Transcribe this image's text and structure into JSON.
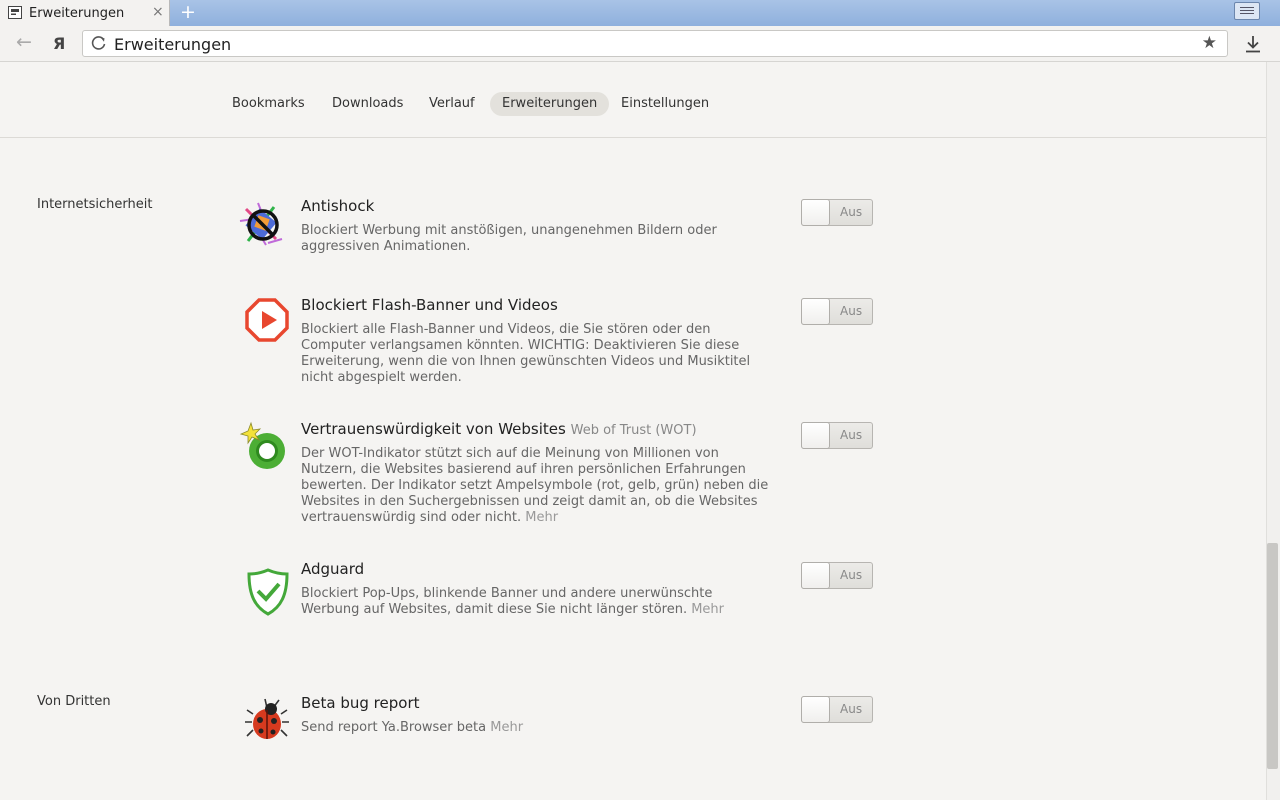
{
  "tab": {
    "title": "Erweiterungen",
    "close": "×"
  },
  "newtab": "+",
  "toolbar": {
    "address": "Erweiterungen",
    "back": "←",
    "ya": "Я",
    "star": "★"
  },
  "nav": [
    "Bookmarks",
    "Downloads",
    "Verlauf",
    "Erweiterungen",
    "Einstellungen"
  ],
  "nav_active": "Erweiterungen",
  "sections": {
    "security": "Internetsicherheit",
    "third": "Von Dritten"
  },
  "extensions": [
    {
      "title": "Antishock",
      "subtitle": "",
      "desc": "Blockiert Werbung mit anstößigen, unangenehmen Bildern oder aggressiven Animationen.",
      "more": "",
      "icon": "antishock-icon",
      "toggle": "Aus"
    },
    {
      "title": "Blockiert Flash-Banner und Videos",
      "subtitle": "",
      "desc": "Blockiert alle Flash-Banner und Videos, die Sie stören oder den Computer verlangsamen könnten. WICHTIG: Deaktivieren Sie diese Erweiterung, wenn die von Ihnen gewünschten Videos und Musiktitel nicht abgespielt werden.",
      "more": "",
      "icon": "flash-blocker-icon",
      "toggle": "Aus"
    },
    {
      "title": "Vertrauenswürdigkeit von Websites",
      "subtitle": "Web of Trust (WOT)",
      "desc": "Der WOT-Indikator stützt sich auf die Meinung von Millionen von Nutzern, die Websites basierend auf ihren persönlichen Erfahrungen bewerten. Der Indikator setzt Ampelsymbole (rot, gelb, grün) neben die Websites in den Suchergebnissen und zeigt damit an, ob die Websites vertrauenswürdig sind oder nicht.",
      "more": "Mehr",
      "icon": "wot-icon",
      "toggle": "Aus"
    },
    {
      "title": "Adguard",
      "subtitle": "",
      "desc": "Blockiert Pop-Ups, blinkende Banner und andere unerwünschte Werbung auf Websites, damit diese Sie nicht länger stören.",
      "more": "Mehr",
      "icon": "adguard-shield-icon",
      "toggle": "Aus"
    },
    {
      "title": "Beta bug report",
      "subtitle": "",
      "desc": "Send report Ya.Browser beta",
      "more": "Mehr",
      "icon": "ladybug-icon",
      "toggle": "Aus"
    }
  ]
}
